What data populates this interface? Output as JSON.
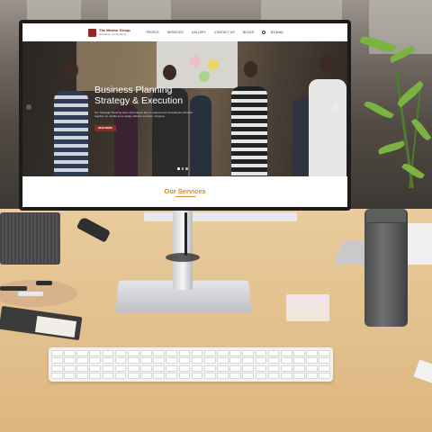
{
  "site": {
    "brand_name": "The Mentor Group",
    "brand_tagline": "Elevating. Accelerating",
    "nav_items": [
      "PEOPLE",
      "SERVICES",
      "GALLERY",
      "CONTACT US",
      "BLOGS"
    ],
    "nav_lang": "EN MAIL",
    "hero": {
      "title": "Business Planning Strategy & Execution",
      "description": "Our Strategic Planning team will analyse all our experienced Consultants will work together on results as to design efficient success. Ongoing",
      "button_label": "READ MORE",
      "slides": 3,
      "active_slide": 1
    },
    "services_title": "Our Services"
  },
  "colors": {
    "brand": "#8e2a23",
    "accent": "#d98a27"
  },
  "icons": {
    "logo": "shield-logo-icon",
    "search": "search-icon",
    "flag": "flag-icon"
  }
}
